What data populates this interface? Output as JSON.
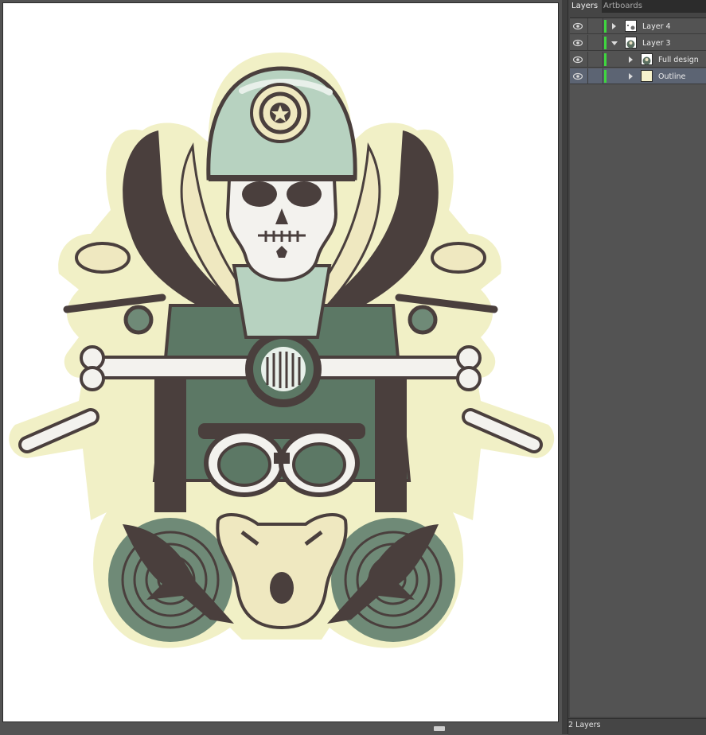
{
  "panel": {
    "tabs": [
      {
        "label": "Layers",
        "active": true
      },
      {
        "label": "Artboards",
        "active": false
      }
    ],
    "layers": [
      {
        "name": "Layer 4",
        "expanded": false,
        "visible": true,
        "selected": false,
        "depth": 0
      },
      {
        "name": "Layer 3",
        "expanded": true,
        "visible": true,
        "selected": false,
        "depth": 0
      },
      {
        "name": "Full design",
        "expanded": false,
        "visible": true,
        "selected": false,
        "depth": 1
      },
      {
        "name": "Outline",
        "expanded": false,
        "visible": true,
        "selected": true,
        "depth": 1
      }
    ],
    "layer_color": "#3fd63f",
    "footer": "2 Layers"
  },
  "artwork": {
    "colors": {
      "outline_glow": "#f1f0c6",
      "cream": "#efe8c0",
      "dark_brown": "#4a3f3d",
      "sage_green": "#6f8a77",
      "light_sage": "#b7d2c0",
      "mid_green": "#5c7865"
    }
  }
}
